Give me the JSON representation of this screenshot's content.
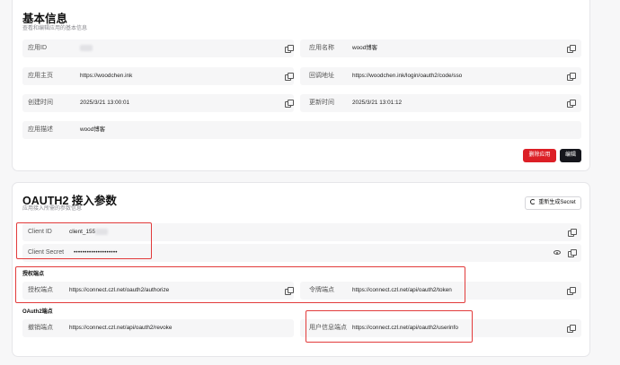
{
  "basic": {
    "title": "基本信息",
    "subtitle": "查看和编辑应用的基本信息",
    "fields": {
      "app_id": {
        "label": "应用ID",
        "value": ""
      },
      "app_name": {
        "label": "应用名称",
        "value": "wood博客"
      },
      "homepage": {
        "label": "应用主页",
        "value": "https://woodchen.ink"
      },
      "callback": {
        "label": "回调地址",
        "value": "https://woodchen.ink/login/oauth2/code/sso"
      },
      "created": {
        "label": "创建时间",
        "value": "2025/3/21 13:00:01"
      },
      "updated": {
        "label": "更新时间",
        "value": "2025/3/21 13:01:12"
      },
      "description": {
        "label": "应用描述",
        "value": "wood博客"
      }
    },
    "delete_label": "删除应用",
    "edit_label": "编辑"
  },
  "oauth": {
    "title": "OAUTH2 接入参数",
    "subtitle": "应用接入所需的参数信息",
    "regen_label": "重新生成Secret",
    "client_id": {
      "label": "Client ID",
      "value": "client_155"
    },
    "client_secret": {
      "label": "Client Secret",
      "value": "••••••••••••••••••••"
    },
    "auth_section": "授权端点",
    "authorize": {
      "label": "授权端点",
      "value": "https://connect.czl.net/oauth2/authorize"
    },
    "token": {
      "label": "令牌端点",
      "value": "https://connect.czl.net/api/oauth2/token"
    },
    "api_section": "OAuth2端点",
    "revoke": {
      "label": "撤销端点",
      "value": "https://connect.czl.net/api/oauth2/revoke"
    },
    "userinfo": {
      "label": "用户信息端点",
      "value": "https://connect.czl.net/api/oauth2/userinfo"
    }
  },
  "colors": {
    "accent_red": "#dc1f26",
    "highlight_box": "#e23b3b",
    "dark_button": "#15161c"
  }
}
